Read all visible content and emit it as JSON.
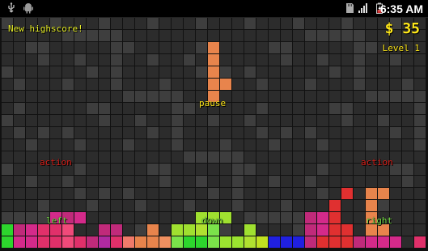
{
  "status_bar": {
    "time": "6:35 AM",
    "icons": [
      "usb-icon",
      "android-debug-icon",
      "sd-card-icon",
      "signal-icon",
      "battery-charging-icon"
    ]
  },
  "hud": {
    "highscore_message": "New highscore!",
    "score": "$ 35",
    "level": "Level 1",
    "pause_label": "pause",
    "action_left_label": "action",
    "action_right_label": "action",
    "left_label": "left",
    "down_label": "down",
    "right_label": "right"
  },
  "colors": {
    "background": "#111111",
    "empty_cell_dark": "#2c2c2c",
    "empty_cell_light": "#3e3e3e",
    "text_yellow": "#ffe81a",
    "control_red": "#e0201a",
    "control_green": "#7be34a",
    "falling_piece": "#e8844c"
  },
  "board": {
    "columns": 35,
    "rows": 19,
    "falling_piece": {
      "color": "#e8844c",
      "cells": [
        [
          17,
          2
        ],
        [
          17,
          3
        ],
        [
          17,
          4
        ],
        [
          17,
          5
        ],
        [
          18,
          5
        ],
        [
          17,
          6
        ]
      ]
    }
  }
}
